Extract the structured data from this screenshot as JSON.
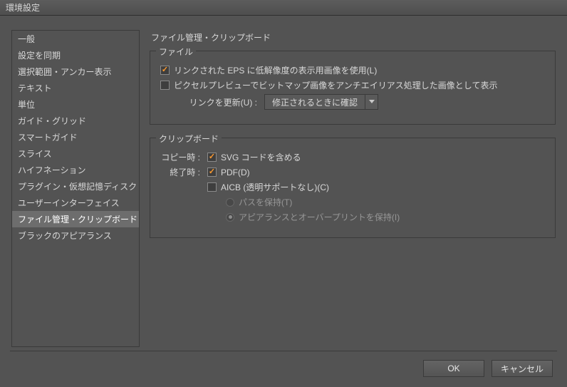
{
  "window": {
    "title": "環境設定"
  },
  "sidebar": {
    "items": [
      "一般",
      "設定を同期",
      "選択範囲・アンカー表示",
      "テキスト",
      "単位",
      "ガイド・グリッド",
      "スマートガイド",
      "スライス",
      "ハイフネーション",
      "プラグイン・仮想記憶ディスク",
      "ユーザーインターフェイス",
      "ファイル管理・クリップボード",
      "ブラックのアピアランス"
    ],
    "selected_index": 11
  },
  "main": {
    "title": "ファイル管理・クリップボード",
    "file_section": {
      "legend": "ファイル",
      "use_low_res_eps": {
        "label": "リンクされた EPS に低解像度の表示用画像を使用(L)",
        "checked": true
      },
      "pixel_preview_aa": {
        "label": "ピクセルプレビューでビットマップ画像をアンチエイリアス処理した画像として表示",
        "checked": false
      },
      "update_links": {
        "label": "リンクを更新(U) :",
        "value": "修正されるときに確認"
      }
    },
    "clipboard_section": {
      "legend": "クリップボード",
      "copy_label": "コピー時 :",
      "quit_label": "終了時 :",
      "svg_code": {
        "label": "SVG コードを含める",
        "checked": true
      },
      "pdf": {
        "label": "PDF(D)",
        "checked": true
      },
      "aicb": {
        "label": "AICB (透明サポートなし)(C)",
        "checked": false
      },
      "radio_path": {
        "label": "パスを保持(T)"
      },
      "radio_appearance": {
        "label": "アピアランスとオーバープリントを保持(I)"
      }
    }
  },
  "buttons": {
    "ok": "OK",
    "cancel": "キャンセル"
  }
}
